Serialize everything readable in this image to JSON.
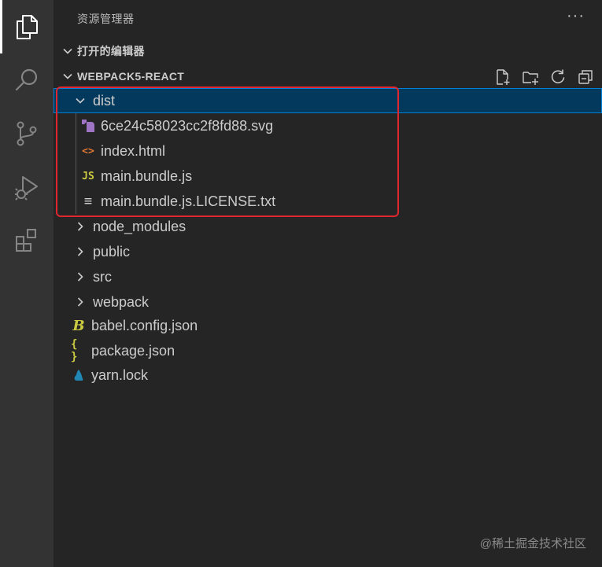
{
  "explorer": {
    "title": "资源管理器",
    "more_actions": "···",
    "open_editors": {
      "label": "打开的编辑器",
      "expanded": true
    },
    "workspace": {
      "label": "WEBPACK5-REACT",
      "expanded": true,
      "actions": [
        "new-file-icon",
        "new-folder-icon",
        "refresh-icon",
        "collapse-all-icon"
      ]
    },
    "tree": [
      {
        "name": "dist",
        "type": "folder",
        "expanded": true,
        "selected": true,
        "depth": 0
      },
      {
        "name": "6ce24c58023cc2f8fd88.svg",
        "type": "svg",
        "depth": 1
      },
      {
        "name": "index.html",
        "type": "html",
        "depth": 1
      },
      {
        "name": "main.bundle.js",
        "type": "js",
        "depth": 1
      },
      {
        "name": "main.bundle.js.LICENSE.txt",
        "type": "txt",
        "depth": 1
      },
      {
        "name": "node_modules",
        "type": "folder",
        "expanded": false,
        "depth": 0
      },
      {
        "name": "public",
        "type": "folder",
        "expanded": false,
        "depth": 0
      },
      {
        "name": "src",
        "type": "folder",
        "expanded": false,
        "depth": 0
      },
      {
        "name": "webpack",
        "type": "folder",
        "expanded": false,
        "depth": 0
      },
      {
        "name": "babel.config.json",
        "type": "babel",
        "depth": 0
      },
      {
        "name": "package.json",
        "type": "json",
        "depth": 0
      },
      {
        "name": "yarn.lock",
        "type": "yarn",
        "depth": 0
      }
    ]
  },
  "icon_glyphs": {
    "js": "JS",
    "html": "<>",
    "json": "{ }",
    "txt": "≡",
    "babel": "B"
  },
  "colors": {
    "selection": "#04395e",
    "selection_border": "#007fd4",
    "highlight_box": "#e0262e",
    "svg_icon": "#a074c4",
    "html_icon": "#e37933",
    "js_icon": "#cbcb41",
    "json_icon": "#cbcb41",
    "babel_icon": "#cbcb41",
    "yarn_icon": "#2188b6"
  },
  "watermark": "@稀土掘金技术社区"
}
